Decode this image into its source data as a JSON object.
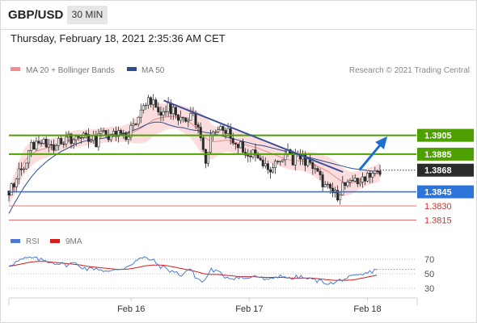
{
  "header": {
    "pair": "GBP/USD",
    "timeframe": "30 MIN",
    "timestamp": "Thursday, February 18, 2021 2:35:36 AM CET"
  },
  "legend": {
    "ma20": "MA 20 + Bollinger Bands",
    "ma50": "MA 50",
    "copyright": "Research © 2021 Trading Central",
    "rsi": "RSI",
    "rsi_ma": "9MA"
  },
  "colors": {
    "up_candle": "#ffffff",
    "down_candle": "#2b2b2b",
    "bollinger_fill": "#f9d2d2",
    "ma20": "#e78c8c",
    "ma50": "#2c4d8f",
    "resistance": "#4ea000",
    "support": "#2e73d8",
    "weak_support": "#e57373",
    "rsi": "#4b7bd1",
    "rsi_ma": "#d81b1b",
    "last_price_label": "#2b2b2b"
  },
  "chart_data": [
    {
      "type": "candlestick",
      "title": "GBP/USD",
      "timeframe": "30 MIN",
      "x_ticks": [
        "Feb 16",
        "Feb 17",
        "Feb 18"
      ],
      "ylim": [
        1.38,
        1.3963
      ],
      "last_price": "1.3868",
      "levels": [
        {
          "value": "1.3905",
          "kind": "resistance"
        },
        {
          "value": "1.3885",
          "kind": "resistance"
        },
        {
          "value": "1.3868",
          "kind": "last_price"
        },
        {
          "value": "1.3845",
          "kind": "support"
        },
        {
          "value": "1.3830",
          "kind": "weak_support"
        },
        {
          "value": "1.3815",
          "kind": "weak_support"
        }
      ],
      "close_path": [
        1.3846,
        1.3858,
        1.3874,
        1.3892,
        1.3898,
        1.3895,
        1.3889,
        1.3897,
        1.3905,
        1.3899,
        1.3906,
        1.3903,
        1.3898,
        1.3908,
        1.3903,
        1.3906,
        1.3902,
        1.3912,
        1.3928,
        1.3944,
        1.3941,
        1.3931,
        1.3936,
        1.3928,
        1.3919,
        1.3931,
        1.3914,
        1.3875,
        1.391,
        1.3918,
        1.3907,
        1.3901,
        1.3894,
        1.3884,
        1.3886,
        1.3875,
        1.3866,
        1.3881,
        1.3887,
        1.3879,
        1.3883,
        1.3876,
        1.3866,
        1.3856,
        1.385,
        1.384,
        1.3852,
        1.3856,
        1.3858,
        1.3862,
        1.3866,
        1.3869
      ],
      "ma20": [
        1.3838,
        1.3858,
        1.3876,
        1.3885,
        1.3889,
        1.3891,
        1.3893,
        1.3896,
        1.3899,
        1.3901,
        1.3902,
        1.3903,
        1.3904,
        1.3905,
        1.3906,
        1.3906,
        1.3907,
        1.3908,
        1.3912,
        1.3917,
        1.3922,
        1.3924,
        1.3925,
        1.3925,
        1.3922,
        1.3918,
        1.3911,
        1.3902,
        1.3898,
        1.3899,
        1.39,
        1.3898,
        1.3896,
        1.3894,
        1.3892,
        1.3889,
        1.3886,
        1.3883,
        1.388,
        1.3878,
        1.3878,
        1.3877,
        1.3874,
        1.387,
        1.3866,
        1.386,
        1.3855,
        1.3854,
        1.3857,
        1.386,
        1.3863,
        1.3866
      ],
      "ma50": [
        1.3822,
        1.3836,
        1.3849,
        1.386,
        1.3869,
        1.3876,
        1.3882,
        1.3887,
        1.3891,
        1.3895,
        1.3898,
        1.39,
        1.3901,
        1.3902,
        1.3903,
        1.3905,
        1.3907,
        1.391,
        1.3913,
        1.3917,
        1.3919,
        1.3919,
        1.3916,
        1.3914,
        1.3913,
        1.3911,
        1.391,
        1.3908,
        1.3907,
        1.3905,
        1.3903,
        1.3901,
        1.3899,
        1.3897,
        1.3895,
        1.3894,
        1.3892,
        1.389,
        1.3888,
        1.3886,
        1.3884,
        1.3882,
        1.388,
        1.3878,
        1.3876,
        1.3874,
        1.3872,
        1.387,
        1.3869,
        1.3868,
        1.3867,
        1.3866
      ],
      "bollinger_half_width": [
        0.0008,
        0.0012,
        0.0014,
        0.0013,
        0.0011,
        0.001,
        0.0009,
        0.0008,
        0.0009,
        0.0009,
        0.0009,
        0.0008,
        0.0008,
        0.0008,
        0.0008,
        0.0008,
        0.0009,
        0.0011,
        0.0016,
        0.0019,
        0.0017,
        0.0015,
        0.0013,
        0.0013,
        0.0014,
        0.0016,
        0.002,
        0.0023,
        0.0018,
        0.0014,
        0.0012,
        0.0012,
        0.0012,
        0.0012,
        0.0011,
        0.0011,
        0.0011,
        0.001,
        0.001,
        0.001,
        0.001,
        0.0011,
        0.0013,
        0.0015,
        0.0016,
        0.0017,
        0.0015,
        0.0012,
        0.001,
        0.0009,
        0.0009,
        0.001
      ],
      "trendline": {
        "from": [
          0.38,
          1.3942
        ],
        "to": [
          0.82,
          1.3866
        ]
      },
      "projection": {
        "from": [
          0.86,
          1.3868
        ],
        "to": [
          0.925,
          1.3902
        ]
      }
    },
    {
      "type": "line",
      "title": "RSI",
      "y_ticks": [
        "70",
        "50",
        "30"
      ],
      "ylim": [
        20,
        80
      ],
      "series": [
        {
          "name": "RSI",
          "values": [
            62,
            66,
            70,
            72,
            70,
            68,
            66,
            64,
            62,
            65,
            60,
            56,
            58,
            55,
            52,
            56,
            58,
            64,
            70,
            72,
            68,
            60,
            56,
            52,
            48,
            58,
            44,
            38,
            56,
            52,
            46,
            44,
            46,
            42,
            48,
            44,
            40,
            46,
            48,
            42,
            46,
            44,
            42,
            40,
            38,
            36,
            42,
            44,
            46,
            48,
            52,
            56
          ]
        },
        {
          "name": "9MA",
          "values": [
            60,
            62,
            64,
            66,
            67,
            67,
            66,
            65,
            64,
            63,
            62,
            60,
            59,
            58,
            57,
            56,
            56,
            57,
            59,
            61,
            62,
            62,
            61,
            59,
            57,
            55,
            53,
            50,
            49,
            49,
            48,
            47,
            46,
            46,
            46,
            45,
            45,
            45,
            45,
            44,
            44,
            44,
            44,
            43,
            42,
            41,
            41,
            41,
            42,
            44,
            46,
            48
          ]
        }
      ],
      "last_value_projection": 56
    }
  ]
}
